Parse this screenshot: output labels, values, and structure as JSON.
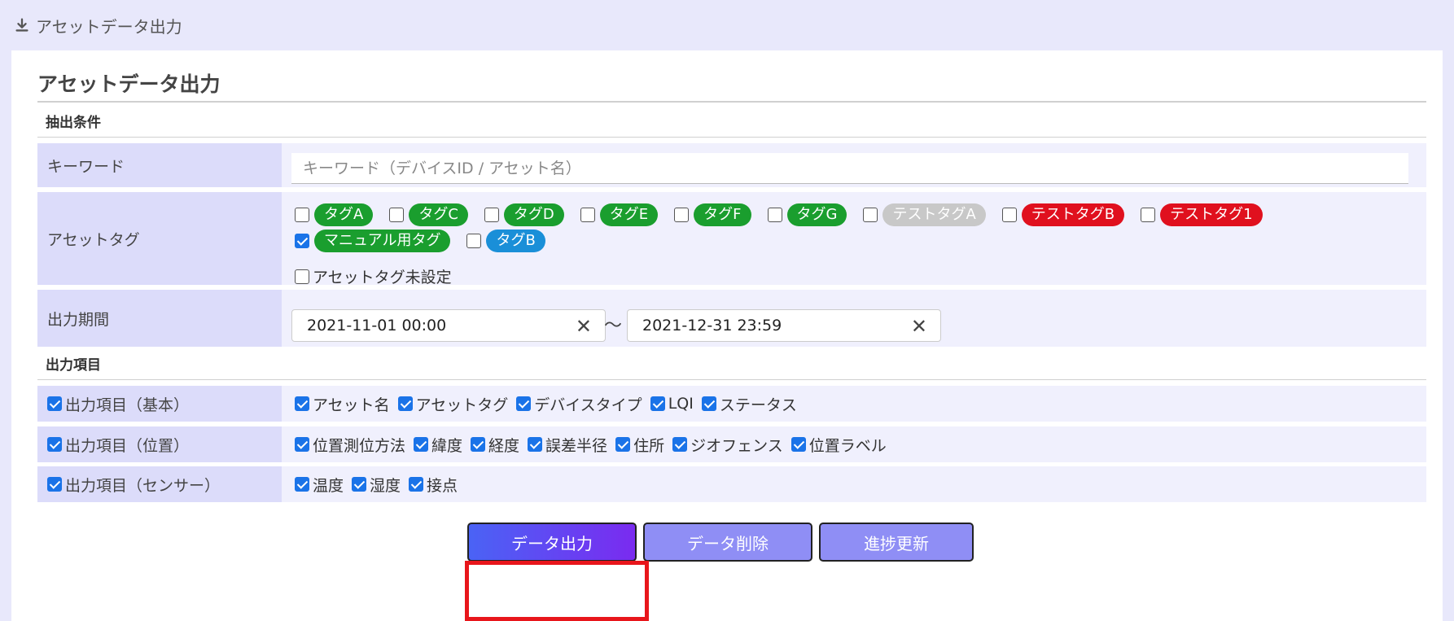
{
  "breadcrumb": "アセットデータ出力",
  "page_title": "アセットデータ出力",
  "sections": {
    "filter": "抽出条件",
    "output": "出力項目"
  },
  "keyword": {
    "label": "キーワード",
    "placeholder": "キーワード（デバイスID / アセット名）",
    "value": ""
  },
  "asset_tags": {
    "label": "アセットタグ",
    "tags": [
      {
        "name": "タグA",
        "color": "#1a9e2e",
        "checked": false
      },
      {
        "name": "タグC",
        "color": "#1a9e2e",
        "checked": false
      },
      {
        "name": "タグD",
        "color": "#1a9e2e",
        "checked": false
      },
      {
        "name": "タグE",
        "color": "#1a9e2e",
        "checked": false
      },
      {
        "name": "タグF",
        "color": "#1a9e2e",
        "checked": false
      },
      {
        "name": "タグG",
        "color": "#1a9e2e",
        "checked": false
      },
      {
        "name": "テストタグA",
        "color": "#c8c8c8",
        "checked": false
      },
      {
        "name": "テストタグB",
        "color": "#e0101e",
        "checked": false
      },
      {
        "name": "テストタグ1",
        "color": "#e0101e",
        "checked": false
      },
      {
        "name": "マニュアル用タグ",
        "color": "#1a9e2e",
        "checked": true
      },
      {
        "name": "タグB",
        "color": "#1a8fd8",
        "checked": false
      }
    ],
    "untagged_label": "アセットタグ未設定",
    "untagged_checked": false
  },
  "period": {
    "label": "出力期間",
    "start": "2021-11-01 00:00",
    "end": "2021-12-31 23:59",
    "separator": "～",
    "clear_glyph": "✕"
  },
  "output_groups": [
    {
      "label": "出力項目（基本）",
      "checked": true,
      "items": [
        "アセット名",
        "アセットタグ",
        "デバイスタイプ",
        "LQI",
        "ステータス"
      ]
    },
    {
      "label": "出力項目（位置）",
      "checked": true,
      "items": [
        "位置測位方法",
        "緯度",
        "経度",
        "誤差半径",
        "住所",
        "ジオフェンス",
        "位置ラベル"
      ]
    },
    {
      "label": "出力項目（センサー）",
      "checked": true,
      "items": [
        "温度",
        "湿度",
        "接点"
      ]
    }
  ],
  "buttons": {
    "export": "データ出力",
    "delete": "データ削除",
    "refresh": "進捗更新"
  },
  "colors": {
    "highlight": "#e8161b",
    "accent": "#1a73e8"
  }
}
